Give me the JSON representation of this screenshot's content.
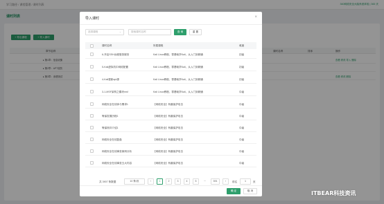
{
  "background": {
    "breadcrumb": "学习路径 / 课程管理 / 课时列表",
    "top_right": "360网络安全大脑系统体验 | 365 天",
    "page_title": "课时列表",
    "buttons": [
      "+ 导出课程",
      "+ 导入课时"
    ],
    "table_headers": [
      "章节名称",
      "课时名称",
      "排序",
      "操作"
    ],
    "rows": [
      {
        "name": "▸ 第1章：信息收集",
        "actions": "查看  修改  导入  删除"
      },
      {
        "name": "▸ 第2章：APT攻防",
        "actions": ""
      },
      {
        "name": "▸ 第3章：渗透测试",
        "actions": "查看  修改  删除"
      }
    ]
  },
  "modal": {
    "title": "导入课时",
    "close": "×",
    "filters": {
      "select_placeholder": "选择课程",
      "input_placeholder": "搜索课时名称",
      "query_button": "查 询",
      "reset_button": "重 置"
    },
    "columns": [
      "课时名称",
      "所属课程",
      "难度"
    ],
    "rows": [
      {
        "name": "6-开启SSH远程登录服务",
        "course": "Kali Linux教程，零基础学Kali，从入门到精通",
        "level": "初级"
      },
      {
        "name": "5-Kali虚拟机中网络配置",
        "course": "Kali Linux教程，零基础学Kali，从入门到精通",
        "level": "初级"
      },
      {
        "name": "4-Kali更新apt源",
        "course": "Kali Linux教程，零基础学Kali，从入门到精通",
        "level": "初级"
      },
      {
        "name": "3-1-MSF架构之模块msf",
        "course": "Kali Linux教程，零基础学Kali，从入门到精通",
        "level": "中级"
      },
      {
        "name": "网络安全在线体与需求1",
        "course": "【网络安全】有趣保护攻击",
        "level": "中级"
      },
      {
        "name": "等保发展历程1",
        "course": "【网络安全】有趣保护攻击",
        "level": "中级"
      },
      {
        "name": "等保测评介绍1",
        "course": "【网络安全】有趣保护攻击",
        "level": "中级"
      },
      {
        "name": "网络安全在线复盘",
        "course": "【网络安全】有趣保护攻击",
        "level": "中级"
      },
      {
        "name": "网络安全在线事查案例分析",
        "course": "【网络安全】有趣保护攻击",
        "level": "中级"
      },
      {
        "name": "网络安全在线事查五大内容",
        "course": "【网络安全】有趣保护攻击",
        "level": "中级"
      }
    ],
    "pagination": {
      "total": "共 3907 条数据",
      "page_size": "10 条/页",
      "prev": "‹",
      "pages": [
        "1",
        "2",
        "3",
        "4",
        "5",
        "···",
        "391"
      ],
      "next": "›",
      "jump_label": "前往",
      "jump_value": "1",
      "jump_suffix": "页"
    },
    "ok_button": "确 定",
    "cancel_button": "取 消"
  },
  "watermark": "ITBEAR科技资讯",
  "colors": {
    "accent": "#2e9f6c",
    "mask": "rgba(0,0,0,0.42)"
  }
}
